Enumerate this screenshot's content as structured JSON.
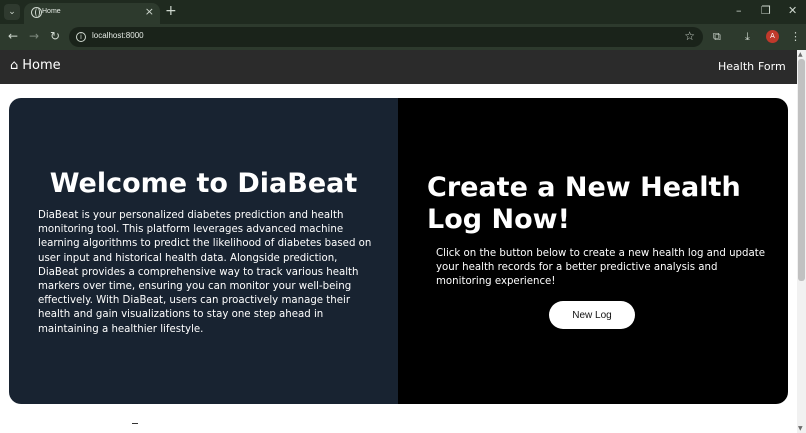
{
  "browser": {
    "tab_title": "Home",
    "url": "localhost:8000",
    "profile_initial": "A",
    "icons": {
      "tab_search": "chevron-down-icon",
      "favicon": "globe-icon",
      "tab_close": "close-icon",
      "new_tab": "plus-icon",
      "minimize": "minimize-icon",
      "restore": "restore-icon",
      "close_window": "close-icon",
      "back": "arrow-left-icon",
      "forward": "arrow-right-icon",
      "reload": "reload-icon",
      "site_info": "info-icon",
      "bookmark": "star-icon",
      "extensions": "puzzle-icon",
      "downloads": "download-icon",
      "menu": "kebab-icon"
    }
  },
  "navbar": {
    "brand": "Home",
    "brand_icon": "home-icon",
    "links": [
      "Health",
      "Form"
    ]
  },
  "hero": {
    "welcome_title": "Welcome to DiaBeat",
    "about_text": "DiaBeat is your personalized diabetes prediction and health monitoring tool. This platform leverages advanced machine learning algorithms to predict the likelihood of diabetes based on user input and historical health data. Alongside prediction, DiaBeat provides a comprehensive way to track various health markers over time, ensuring you can monitor your well-being effectively. With DiaBeat, users can proactively manage their health and gain visualizations to stay one step ahead in maintaining a healthier lifestyle.",
    "cta_title": "Create a New Health Log Now!",
    "cta_description": "Click on the button below to create a new health log and update your health records for a better predictive analysis and monitoring experience!",
    "cta_button": "New Log"
  },
  "colors": {
    "left_panel": "#182331",
    "right_panel": "#000000",
    "navbar": "#2b2b2b",
    "browser_frame": "#2d3a2d",
    "avatar": "#c0392b"
  }
}
